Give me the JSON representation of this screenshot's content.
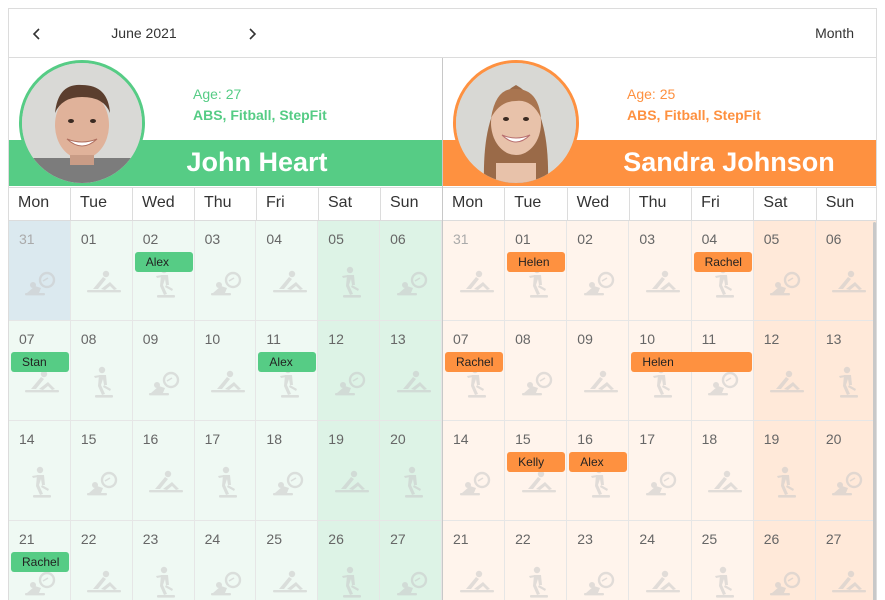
{
  "toolbar": {
    "date_label": "June 2021",
    "view_label": "Month"
  },
  "colors": {
    "green": "#56cc85",
    "orange": "#fe9140",
    "green_cell": "#eff9f3",
    "green_weekend": "#ddf3e6",
    "orange_cell": "#fff4ec",
    "orange_weekend": "#ffe9d9",
    "blue_today": "#dbe9ef"
  },
  "weekdays": [
    "Mon",
    "Tue",
    "Wed",
    "Thu",
    "Fri",
    "Sat",
    "Sun"
  ],
  "resources": [
    {
      "name": "John Heart",
      "age": "Age: 27",
      "skills": "ABS, Fitball, StepFit",
      "color": "#56cc85",
      "cell_color": "#eff9f3",
      "weekend_color": "#ddf3e6",
      "days": [
        "31",
        "01",
        "02",
        "03",
        "04",
        "05",
        "06",
        "07",
        "08",
        "09",
        "10",
        "11",
        "12",
        "13",
        "14",
        "15",
        "16",
        "17",
        "18",
        "19",
        "20",
        "21",
        "22",
        "23",
        "24",
        "25",
        "26",
        "27"
      ],
      "events": [
        {
          "text": "Alex",
          "row": 0,
          "col": 2,
          "span": 1
        },
        {
          "text": "Stan",
          "row": 1,
          "col": 0,
          "span": 1
        },
        {
          "text": "Alex",
          "row": 1,
          "col": 4,
          "span": 1
        },
        {
          "text": "Rachel",
          "row": 3,
          "col": 0,
          "span": 1
        }
      ]
    },
    {
      "name": "Sandra Johnson",
      "age": "Age: 25",
      "skills": "ABS, Fitball, StepFit",
      "color": "#fe9140",
      "cell_color": "#fff4ec",
      "weekend_color": "#ffe9d9",
      "days": [
        "31",
        "01",
        "02",
        "03",
        "04",
        "05",
        "06",
        "07",
        "08",
        "09",
        "10",
        "11",
        "12",
        "13",
        "14",
        "15",
        "16",
        "17",
        "18",
        "19",
        "20",
        "21",
        "22",
        "23",
        "24",
        "25",
        "26",
        "27"
      ],
      "events": [
        {
          "text": "Helen",
          "row": 0,
          "col": 1,
          "span": 1
        },
        {
          "text": "Rachel",
          "row": 0,
          "col": 4,
          "span": 1
        },
        {
          "text": "Rachel",
          "row": 1,
          "col": 0,
          "span": 1
        },
        {
          "text": "Helen",
          "row": 1,
          "col": 3,
          "span": 2
        },
        {
          "text": "Kelly",
          "row": 2,
          "col": 1,
          "span": 1
        },
        {
          "text": "Alex",
          "row": 2,
          "col": 2,
          "span": 1
        }
      ]
    }
  ],
  "icons": [
    "situp-icon",
    "fitball-icon",
    "stepfit-icon"
  ]
}
